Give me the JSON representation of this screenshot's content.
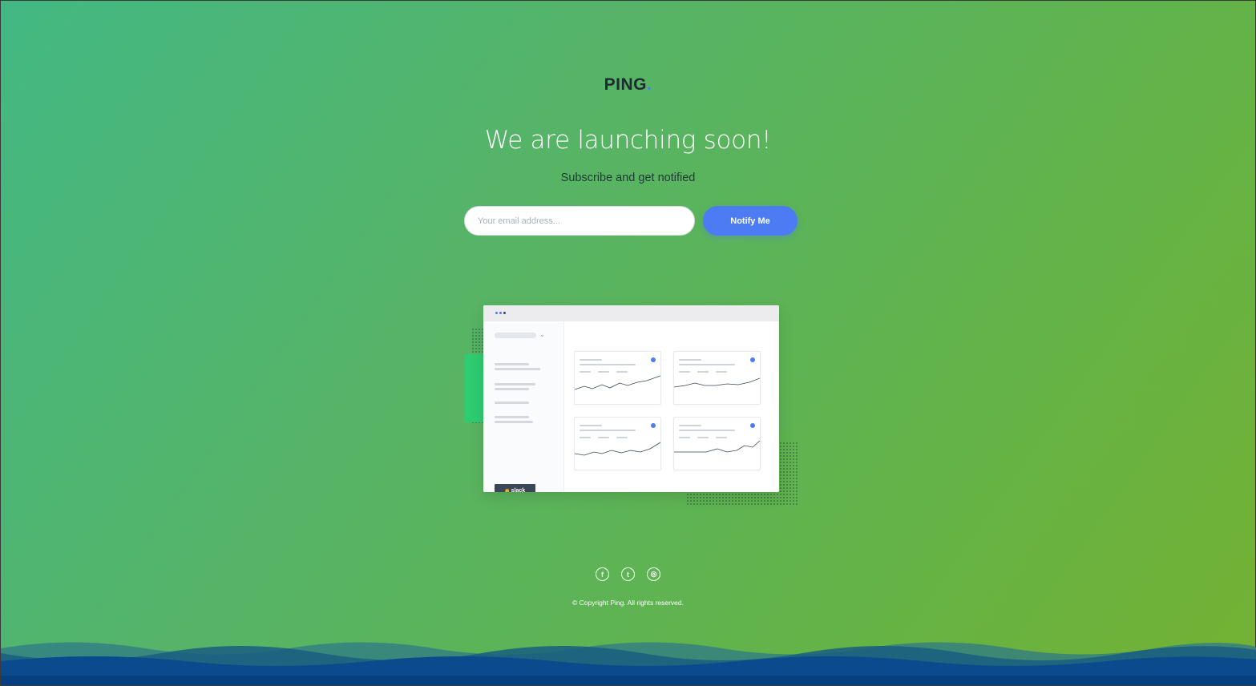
{
  "brand": {
    "name": "PING",
    "dot": ".",
    "accent_color": "#4d7bf3"
  },
  "hero": {
    "headline": "We are launching soon!",
    "subline": "Subscribe and get notified"
  },
  "form": {
    "email_placeholder": "Your email address...",
    "email_value": "",
    "submit_label": "Notify Me"
  },
  "illustration": {
    "integration_label": "slack",
    "integration_icon": "slack-icon"
  },
  "footer": {
    "socials": [
      {
        "name": "facebook",
        "glyph": "f",
        "icon": "facebook-icon"
      },
      {
        "name": "twitter",
        "glyph": "t",
        "icon": "twitter-icon"
      },
      {
        "name": "instagram",
        "glyph": "◎",
        "icon": "instagram-icon"
      }
    ],
    "copyright": "© Copyright Ping. All rights reserved."
  },
  "colors": {
    "gradient_start": "#43b883",
    "gradient_end": "#74b232",
    "button": "#4d7bf3",
    "wave_dark": "#0a4a8a",
    "wave_mid": "#1d5f7a"
  }
}
